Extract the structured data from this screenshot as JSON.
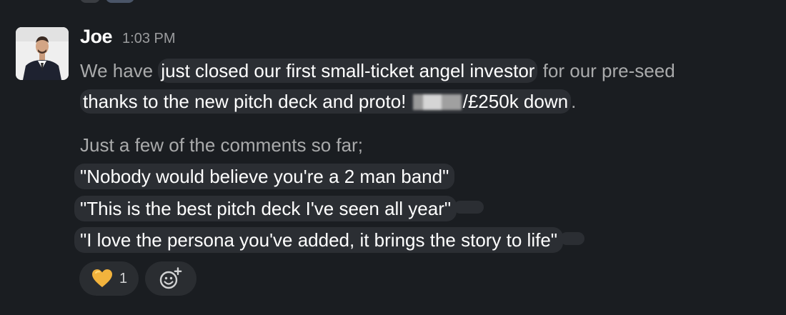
{
  "message": {
    "author": "Joe",
    "timestamp": "1:03 PM",
    "line1": {
      "pre": "We have ",
      "highlight": "just closed our first small-ticket angel investor",
      "post": " for our pre-seed"
    },
    "line2": {
      "pre": "thanks to the new pitch deck and proto! ",
      "post": "/£250k down",
      "end": "."
    },
    "intro": "Just a few of the comments so far;",
    "quotes": [
      "\"Nobody would believe you're a 2 man band\"",
      "\"This is the best pitch deck I've seen all year\"",
      "\"I love the persona you've added, it brings the story to life\""
    ]
  },
  "reactions": [
    {
      "emoji": "yellow-heart",
      "count": "1"
    }
  ],
  "colors": {
    "background": "#1a1d21",
    "highlight": "#2b2e33",
    "heart": "#f2b33d"
  }
}
